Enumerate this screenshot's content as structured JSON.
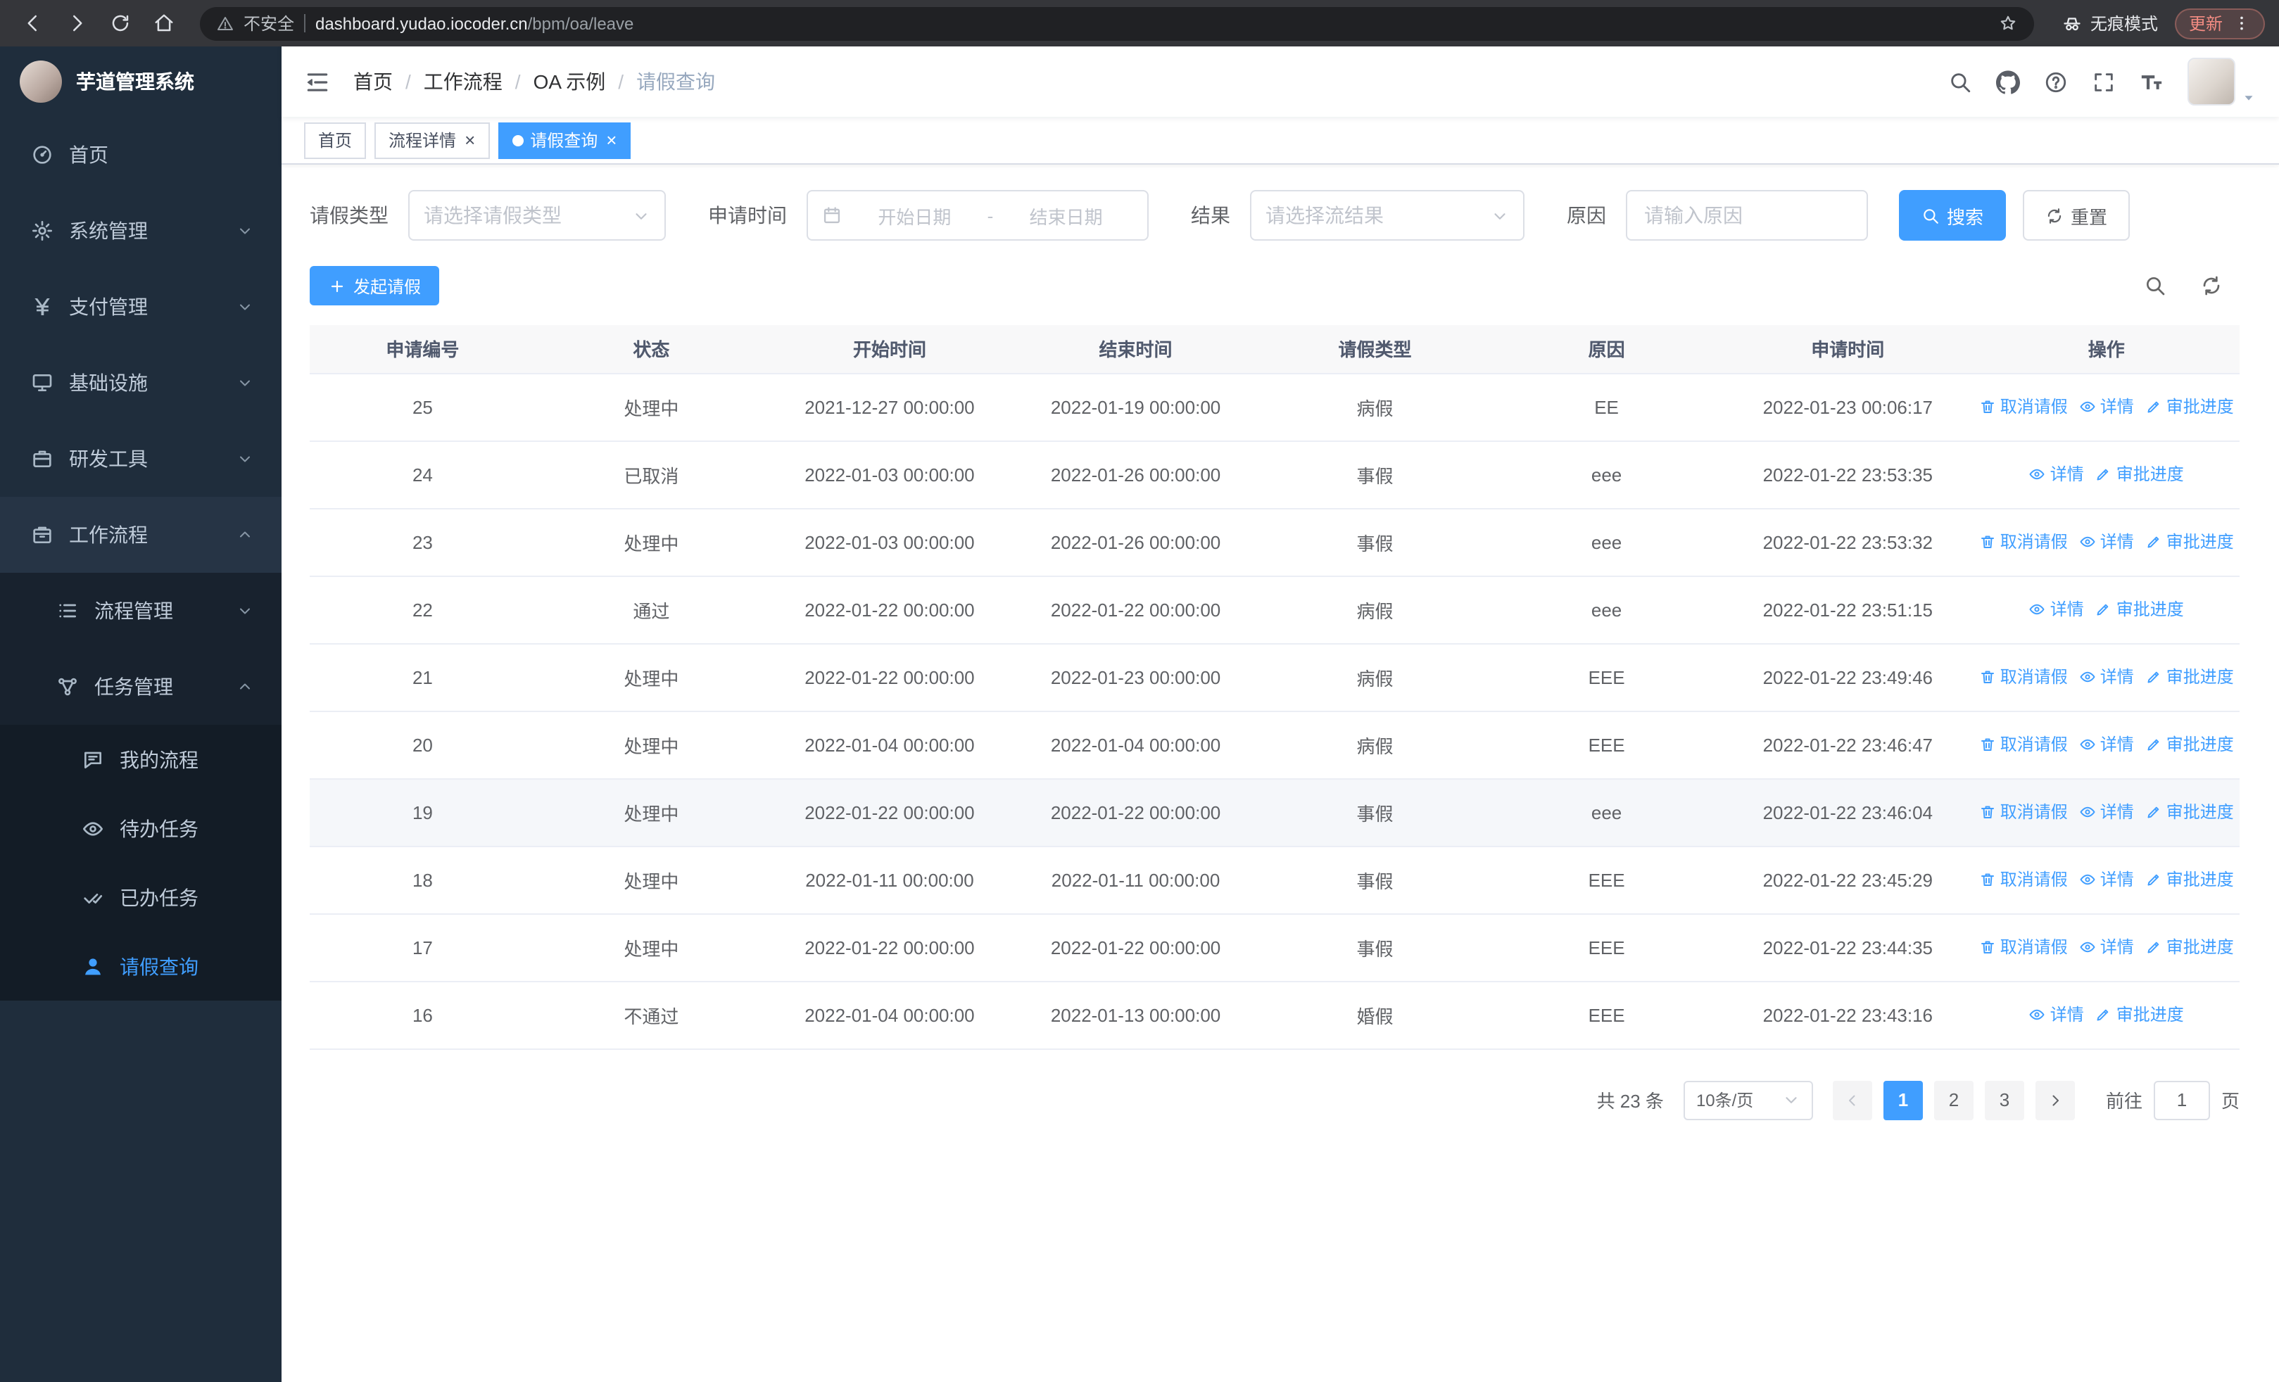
{
  "browser": {
    "security_warning": "不安全",
    "url_host": "dashboard.yudao.iocoder.cn",
    "url_path": "/bpm/oa/leave",
    "incognito_label": "无痕模式",
    "update_label": "更新"
  },
  "sidebar": {
    "app_title": "芋道管理系统",
    "menu": [
      {
        "key": "home",
        "label": "首页",
        "icon": "home",
        "level": 1
      },
      {
        "key": "system-management",
        "label": "系统管理",
        "icon": "gear",
        "level": 1,
        "arrow": "down"
      },
      {
        "key": "payment-management",
        "label": "支付管理",
        "icon": "yen",
        "level": 1,
        "arrow": "down"
      },
      {
        "key": "infrastructure",
        "label": "基础设施",
        "icon": "infra",
        "level": 1,
        "arrow": "down"
      },
      {
        "key": "dev-tools",
        "label": "研发工具",
        "icon": "tools",
        "level": 1,
        "arrow": "down"
      },
      {
        "key": "workflow",
        "label": "工作流程",
        "icon": "workflow",
        "level": 1,
        "arrow": "up",
        "expanded": true
      },
      {
        "key": "process-management",
        "label": "流程管理",
        "icon": "list",
        "level": 2,
        "arrow": "down"
      },
      {
        "key": "task-management",
        "label": "任务管理",
        "icon": "tasks",
        "level": 2,
        "arrow": "up",
        "expanded": true
      },
      {
        "key": "my-process",
        "label": "我的流程",
        "icon": "chat",
        "level": 3
      },
      {
        "key": "todo-tasks",
        "label": "待办任务",
        "icon": "eye",
        "level": 3
      },
      {
        "key": "done-tasks",
        "label": "已办任务",
        "icon": "done",
        "level": 3
      },
      {
        "key": "leave-query",
        "label": "请假查询",
        "icon": "user",
        "level": 3,
        "active": true
      }
    ]
  },
  "header": {
    "breadcrumb": [
      "首页",
      "工作流程",
      "OA 示例",
      "请假查询"
    ]
  },
  "tabs": [
    {
      "key": "home",
      "label": "首页",
      "closable": false,
      "active": false
    },
    {
      "key": "process-detail",
      "label": "流程详情",
      "closable": true,
      "active": false
    },
    {
      "key": "leave-query",
      "label": "请假查询",
      "closable": true,
      "active": true
    }
  ],
  "filters": {
    "leave_type_label": "请假类型",
    "leave_type_placeholder": "请选择请假类型",
    "apply_time_label": "申请时间",
    "start_date_placeholder": "开始日期",
    "range_separator": "-",
    "end_date_placeholder": "结束日期",
    "result_label": "结果",
    "result_placeholder": "请选择流结果",
    "reason_label": "原因",
    "reason_placeholder": "请输入原因",
    "search_label": "搜索",
    "reset_label": "重置"
  },
  "toolbar": {
    "create_label": "发起请假"
  },
  "table": {
    "columns": [
      "申请编号",
      "状态",
      "开始时间",
      "结束时间",
      "请假类型",
      "原因",
      "申请时间",
      "操作"
    ],
    "action_labels": {
      "cancel": "取消请假",
      "detail": "详情",
      "progress": "审批进度"
    },
    "rows": [
      {
        "id": "25",
        "status": "处理中",
        "start": "2021-12-27 00:00:00",
        "end": "2022-01-19 00:00:00",
        "type": "病假",
        "reason": "EE",
        "applyTime": "2022-01-23 00:06:17",
        "actions": [
          "cancel",
          "detail",
          "progress"
        ]
      },
      {
        "id": "24",
        "status": "已取消",
        "start": "2022-01-03 00:00:00",
        "end": "2022-01-26 00:00:00",
        "type": "事假",
        "reason": "eee",
        "applyTime": "2022-01-22 23:53:35",
        "actions": [
          "detail",
          "progress"
        ]
      },
      {
        "id": "23",
        "status": "处理中",
        "start": "2022-01-03 00:00:00",
        "end": "2022-01-26 00:00:00",
        "type": "事假",
        "reason": "eee",
        "applyTime": "2022-01-22 23:53:32",
        "actions": [
          "cancel",
          "detail",
          "progress"
        ]
      },
      {
        "id": "22",
        "status": "通过",
        "start": "2022-01-22 00:00:00",
        "end": "2022-01-22 00:00:00",
        "type": "病假",
        "reason": "eee",
        "applyTime": "2022-01-22 23:51:15",
        "actions": [
          "detail",
          "progress"
        ]
      },
      {
        "id": "21",
        "status": "处理中",
        "start": "2022-01-22 00:00:00",
        "end": "2022-01-23 00:00:00",
        "type": "病假",
        "reason": "EEE",
        "applyTime": "2022-01-22 23:49:46",
        "actions": [
          "cancel",
          "detail",
          "progress"
        ]
      },
      {
        "id": "20",
        "status": "处理中",
        "start": "2022-01-04 00:00:00",
        "end": "2022-01-04 00:00:00",
        "type": "病假",
        "reason": "EEE",
        "applyTime": "2022-01-22 23:46:47",
        "actions": [
          "cancel",
          "detail",
          "progress"
        ]
      },
      {
        "id": "19",
        "status": "处理中",
        "start": "2022-01-22 00:00:00",
        "end": "2022-01-22 00:00:00",
        "type": "事假",
        "reason": "eee",
        "applyTime": "2022-01-22 23:46:04",
        "actions": [
          "cancel",
          "detail",
          "progress"
        ],
        "highlighted": true
      },
      {
        "id": "18",
        "status": "处理中",
        "start": "2022-01-11 00:00:00",
        "end": "2022-01-11 00:00:00",
        "type": "事假",
        "reason": "EEE",
        "applyTime": "2022-01-22 23:45:29",
        "actions": [
          "cancel",
          "detail",
          "progress"
        ]
      },
      {
        "id": "17",
        "status": "处理中",
        "start": "2022-01-22 00:00:00",
        "end": "2022-01-22 00:00:00",
        "type": "事假",
        "reason": "EEE",
        "applyTime": "2022-01-22 23:44:35",
        "actions": [
          "cancel",
          "detail",
          "progress"
        ]
      },
      {
        "id": "16",
        "status": "不通过",
        "start": "2022-01-04 00:00:00",
        "end": "2022-01-13 00:00:00",
        "type": "婚假",
        "reason": "EEE",
        "applyTime": "2022-01-22 23:43:16",
        "actions": [
          "detail",
          "progress"
        ]
      }
    ]
  },
  "pagination": {
    "total_label": "共 23 条",
    "page_size": "10条/页",
    "pages": [
      "1",
      "2",
      "3"
    ],
    "active_page": "1",
    "goto_label": "前往",
    "goto_value": "1",
    "page_suffix": "页"
  },
  "colors": {
    "primary": "#409eff",
    "link": "#409eff",
    "sidebar_bg": "#1f2d3c",
    "chrome_bg": "#35363a",
    "active_tab_bg": "#409eff",
    "update_chip_text": "#f28b82",
    "table_header_bg": "#f8f8f9"
  }
}
